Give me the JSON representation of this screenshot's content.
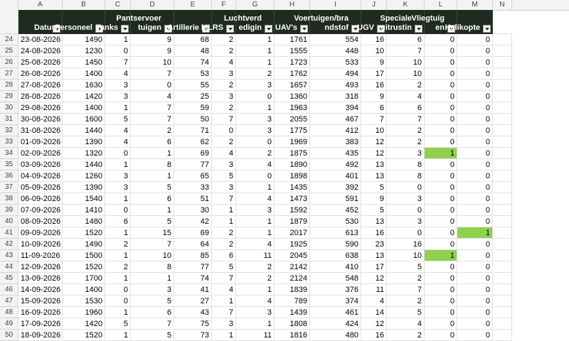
{
  "accent": {
    "header_bg": "#1f2b1f",
    "highlight": "#8fd14f"
  },
  "column_letters": [
    "A",
    "B",
    "C",
    "D",
    "E",
    "F",
    "G",
    "H",
    "I",
    "J",
    "K",
    "L",
    "M",
    "N"
  ],
  "headers": [
    {
      "label": "Datum"
    },
    {
      "label": "Personeel"
    },
    {
      "label": "Tanks"
    },
    {
      "label": "Pantservoer\ntuigen"
    },
    {
      "label": "Artillerie"
    },
    {
      "label": "MLRS"
    },
    {
      "label": "Luchtverd\nedigin"
    },
    {
      "label": "UAV's"
    },
    {
      "label": "Voertuigen/bra\nndstof"
    },
    {
      "label": "UGV"
    },
    {
      "label": "Speciale\nuitrustin"
    },
    {
      "label": "Vliegtuig\nen"
    },
    {
      "label": "Helikopte"
    }
  ],
  "rows": [
    {
      "num": "24",
      "cells": [
        "23-08-2026",
        "1490",
        "1",
        "9",
        "68",
        "2",
        "1",
        "1761",
        "554",
        "16",
        "6",
        "0",
        "0"
      ]
    },
    {
      "num": "25",
      "cells": [
        "24-08-2026",
        "1230",
        "0",
        "9",
        "48",
        "2",
        "1",
        "1555",
        "448",
        "10",
        "7",
        "0",
        "0"
      ]
    },
    {
      "num": "26",
      "cells": [
        "25-08-2026",
        "1450",
        "7",
        "10",
        "74",
        "4",
        "1",
        "1723",
        "533",
        "9",
        "10",
        "0",
        "0"
      ]
    },
    {
      "num": "27",
      "cells": [
        "26-08-2026",
        "1400",
        "4",
        "7",
        "53",
        "3",
        "2",
        "1762",
        "494",
        "17",
        "10",
        "0",
        "0"
      ]
    },
    {
      "num": "28",
      "cells": [
        "27-08-2026",
        "1630",
        "3",
        "0",
        "55",
        "2",
        "3",
        "1657",
        "493",
        "16",
        "2",
        "0",
        "0"
      ]
    },
    {
      "num": "29",
      "cells": [
        "28-08-2026",
        "1420",
        "3",
        "4",
        "25",
        "3",
        "0",
        "1360",
        "318",
        "9",
        "4",
        "0",
        "0"
      ]
    },
    {
      "num": "30",
      "cells": [
        "29-08-2026",
        "1400",
        "1",
        "7",
        "59",
        "2",
        "1",
        "1963",
        "394",
        "6",
        "6",
        "0",
        "0"
      ]
    },
    {
      "num": "31",
      "cells": [
        "30-08-2026",
        "1600",
        "5",
        "7",
        "50",
        "7",
        "3",
        "2055",
        "467",
        "7",
        "7",
        "0",
        "0"
      ]
    },
    {
      "num": "32",
      "cells": [
        "31-08-2026",
        "1440",
        "4",
        "2",
        "71",
        "0",
        "3",
        "1775",
        "412",
        "10",
        "2",
        "0",
        "0"
      ]
    },
    {
      "num": "33",
      "cells": [
        "01-09-2026",
        "1390",
        "4",
        "6",
        "62",
        "2",
        "0",
        "1969",
        "383",
        "12",
        "2",
        "0",
        "0"
      ]
    },
    {
      "num": "34",
      "cells": [
        "02-09-2026",
        "1320",
        "0",
        "1",
        "69",
        "4",
        "2",
        "1875",
        "435",
        "12",
        "3",
        "1",
        "0"
      ]
    },
    {
      "num": "35",
      "cells": [
        "03-09-2026",
        "1440",
        "1",
        "8",
        "77",
        "3",
        "4",
        "1890",
        "492",
        "13",
        "8",
        "0",
        "0"
      ]
    },
    {
      "num": "36",
      "cells": [
        "04-09-2026",
        "1260",
        "3",
        "1",
        "65",
        "5",
        "0",
        "1898",
        "401",
        "13",
        "8",
        "0",
        "0"
      ]
    },
    {
      "num": "37",
      "cells": [
        "05-09-2026",
        "1390",
        "3",
        "5",
        "33",
        "3",
        "1",
        "1435",
        "392",
        "5",
        "0",
        "0",
        "0"
      ]
    },
    {
      "num": "38",
      "cells": [
        "06-09-2026",
        "1540",
        "1",
        "6",
        "51",
        "7",
        "4",
        "1473",
        "591",
        "9",
        "3",
        "0",
        "0"
      ]
    },
    {
      "num": "39",
      "cells": [
        "07-09-2026",
        "1410",
        "0",
        "1",
        "30",
        "1",
        "3",
        "1592",
        "452",
        "5",
        "0",
        "0",
        "0"
      ]
    },
    {
      "num": "40",
      "cells": [
        "08-09-2026",
        "1480",
        "6",
        "5",
        "42",
        "1",
        "1",
        "1879",
        "530",
        "13",
        "3",
        "0",
        "0"
      ]
    },
    {
      "num": "41",
      "cells": [
        "09-09-2026",
        "1520",
        "1",
        "15",
        "69",
        "2",
        "1",
        "2017",
        "613",
        "16",
        "0",
        "0",
        "1"
      ]
    },
    {
      "num": "42",
      "cells": [
        "10-09-2026",
        "1490",
        "2",
        "7",
        "64",
        "2",
        "4",
        "1925",
        "590",
        "23",
        "16",
        "0",
        "0"
      ]
    },
    {
      "num": "43",
      "cells": [
        "11-09-2026",
        "1500",
        "1",
        "10",
        "85",
        "6",
        "11",
        "2045",
        "638",
        "13",
        "10",
        "1",
        "0"
      ]
    },
    {
      "num": "44",
      "cells": [
        "12-09-2026",
        "1520",
        "2",
        "8",
        "77",
        "5",
        "2",
        "2142",
        "410",
        "17",
        "5",
        "0",
        "0"
      ]
    },
    {
      "num": "45",
      "cells": [
        "13-09-2026",
        "1700",
        "1",
        "1",
        "74",
        "7",
        "2",
        "2124",
        "548",
        "12",
        "2",
        "0",
        "0"
      ]
    },
    {
      "num": "46",
      "cells": [
        "14-09-2026",
        "1400",
        "0",
        "3",
        "41",
        "4",
        "1",
        "1839",
        "376",
        "11",
        "7",
        "0",
        "0"
      ]
    },
    {
      "num": "47",
      "cells": [
        "15-09-2026",
        "1530",
        "0",
        "5",
        "27",
        "1",
        "4",
        "789",
        "374",
        "4",
        "2",
        "0",
        "0"
      ]
    },
    {
      "num": "48",
      "cells": [
        "16-09-2026",
        "1960",
        "1",
        "6",
        "43",
        "7",
        "3",
        "1439",
        "461",
        "14",
        "5",
        "0",
        "0"
      ]
    },
    {
      "num": "49",
      "cells": [
        "17-09-2026",
        "1420",
        "5",
        "7",
        "75",
        "3",
        "1",
        "1808",
        "424",
        "12",
        "4",
        "0",
        "0"
      ]
    },
    {
      "num": "50",
      "cells": [
        "18-09-2026",
        "1520",
        "1",
        "5",
        "73",
        "1",
        "11",
        "1816",
        "480",
        "16",
        "2",
        "0",
        "0"
      ]
    }
  ]
}
